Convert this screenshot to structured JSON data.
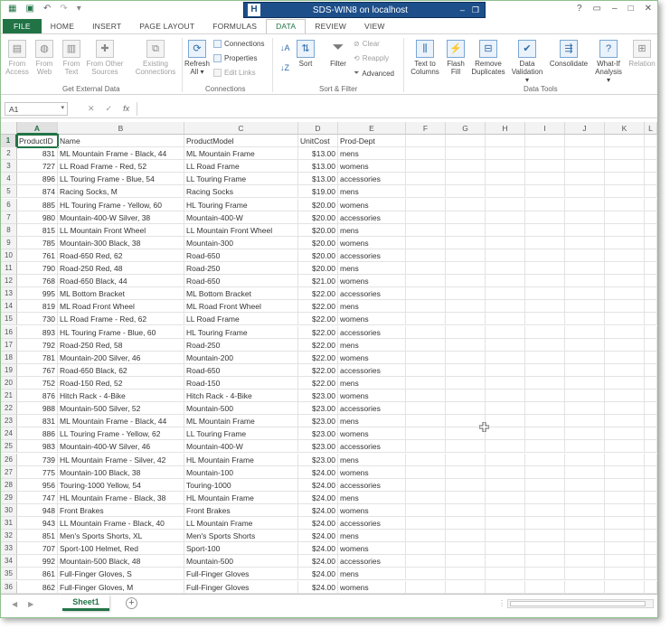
{
  "window": {
    "remote_title": "SDS-WIN8 on localhost",
    "remote_icon": "H"
  },
  "ribbon_tabs": [
    "FILE",
    "HOME",
    "INSERT",
    "PAGE LAYOUT",
    "FORMULAS",
    "DATA",
    "REVIEW",
    "VIEW"
  ],
  "ribbon": {
    "get_external": {
      "label": "Get External Data",
      "from_access": [
        "From",
        "Access"
      ],
      "from_web": [
        "From",
        "Web"
      ],
      "from_text": [
        "From",
        "Text"
      ],
      "from_other": [
        "From Other",
        "Sources"
      ],
      "existing": [
        "Existing",
        "Connections"
      ]
    },
    "connections": {
      "label": "Connections",
      "refresh": [
        "Refresh",
        "All"
      ],
      "connections": "Connections",
      "properties": "Properties",
      "edit_links": "Edit Links"
    },
    "sort_filter": {
      "label": "Sort & Filter",
      "sort": "Sort",
      "filter": "Filter",
      "clear": "Clear",
      "reapply": "Reapply",
      "advanced": "Advanced"
    },
    "data_tools": {
      "label": "Data Tools",
      "text_to_columns": [
        "Text to",
        "Columns"
      ],
      "flash_fill": [
        "Flash",
        "Fill"
      ],
      "remove_dup": [
        "Remove",
        "Duplicates"
      ],
      "data_validation": [
        "Data",
        "Validation"
      ],
      "consolidate": "Consolidate",
      "what_if": [
        "What-If",
        "Analysis"
      ],
      "relationships": "Relation"
    }
  },
  "formula_bar": {
    "name_box": "A1",
    "fx": "fx",
    "value": ""
  },
  "columns": [
    "A",
    "B",
    "C",
    "D",
    "E",
    "F",
    "G",
    "H",
    "I",
    "J",
    "K",
    "L"
  ],
  "headers": [
    "ProductID",
    "Name",
    "ProductModel",
    "UnitCost",
    "Prod-Dept"
  ],
  "rows": [
    [
      "831",
      "ML Mountain Frame - Black, 44",
      "ML Mountain Frame",
      "$13.00",
      "mens"
    ],
    [
      "727",
      "LL Road Frame - Red, 52",
      "LL Road Frame",
      "$13.00",
      "womens"
    ],
    [
      "896",
      "LL Touring Frame - Blue, 54",
      "LL Touring Frame",
      "$13.00",
      "accessories"
    ],
    [
      "874",
      "Racing Socks, M",
      "Racing Socks",
      "$19.00",
      "mens"
    ],
    [
      "885",
      "HL Touring Frame - Yellow, 60",
      "HL Touring Frame",
      "$20.00",
      "womens"
    ],
    [
      "980",
      "Mountain-400-W Silver, 38",
      "Mountain-400-W",
      "$20.00",
      "accessories"
    ],
    [
      "815",
      "LL Mountain Front Wheel",
      "LL Mountain Front Wheel",
      "$20.00",
      "mens"
    ],
    [
      "785",
      "Mountain-300 Black, 38",
      "Mountain-300",
      "$20.00",
      "womens"
    ],
    [
      "761",
      "Road-650 Red, 62",
      "Road-650",
      "$20.00",
      "accessories"
    ],
    [
      "790",
      "Road-250 Red, 48",
      "Road-250",
      "$20.00",
      "mens"
    ],
    [
      "768",
      "Road-650 Black, 44",
      "Road-650",
      "$21.00",
      "womens"
    ],
    [
      "995",
      "ML Bottom Bracket",
      "ML Bottom Bracket",
      "$22.00",
      "accessories"
    ],
    [
      "819",
      "ML Road Front Wheel",
      "ML Road Front Wheel",
      "$22.00",
      "mens"
    ],
    [
      "730",
      "LL Road Frame - Red, 62",
      "LL Road Frame",
      "$22.00",
      "womens"
    ],
    [
      "893",
      "HL Touring Frame - Blue, 60",
      "HL Touring Frame",
      "$22.00",
      "accessories"
    ],
    [
      "792",
      "Road-250 Red, 58",
      "Road-250",
      "$22.00",
      "mens"
    ],
    [
      "781",
      "Mountain-200 Silver, 46",
      "Mountain-200",
      "$22.00",
      "womens"
    ],
    [
      "767",
      "Road-650 Black, 62",
      "Road-650",
      "$22.00",
      "accessories"
    ],
    [
      "752",
      "Road-150 Red, 52",
      "Road-150",
      "$22.00",
      "mens"
    ],
    [
      "876",
      "Hitch Rack - 4-Bike",
      "Hitch Rack - 4-Bike",
      "$23.00",
      "womens"
    ],
    [
      "988",
      "Mountain-500 Silver, 52",
      "Mountain-500",
      "$23.00",
      "accessories"
    ],
    [
      "831",
      "ML Mountain Frame - Black, 44",
      "ML Mountain Frame",
      "$23.00",
      "mens"
    ],
    [
      "886",
      "LL Touring Frame - Yellow, 62",
      "LL Touring Frame",
      "$23.00",
      "womens"
    ],
    [
      "983",
      "Mountain-400-W Silver, 46",
      "Mountain-400-W",
      "$23.00",
      "accessories"
    ],
    [
      "739",
      "HL Mountain Frame - Silver, 42",
      "HL Mountain Frame",
      "$23.00",
      "mens"
    ],
    [
      "775",
      "Mountain-100 Black, 38",
      "Mountain-100",
      "$24.00",
      "womens"
    ],
    [
      "956",
      "Touring-1000 Yellow, 54",
      "Touring-1000",
      "$24.00",
      "accessories"
    ],
    [
      "747",
      "HL Mountain Frame - Black, 38",
      "HL Mountain Frame",
      "$24.00",
      "mens"
    ],
    [
      "948",
      "Front Brakes",
      "Front Brakes",
      "$24.00",
      "womens"
    ],
    [
      "943",
      "LL Mountain Frame - Black, 40",
      "LL Mountain Frame",
      "$24.00",
      "accessories"
    ],
    [
      "851",
      "Men's Sports Shorts, XL",
      "Men's Sports Shorts",
      "$24.00",
      "mens"
    ],
    [
      "707",
      "Sport-100 Helmet, Red",
      "Sport-100",
      "$24.00",
      "womens"
    ],
    [
      "992",
      "Mountain-500 Black, 48",
      "Mountain-500",
      "$24.00",
      "accessories"
    ],
    [
      "861",
      "Full-Finger Gloves, S",
      "Full-Finger Gloves",
      "$24.00",
      "mens"
    ],
    [
      "862",
      "Full-Finger Gloves, M",
      "Full-Finger Gloves",
      "$24.00",
      "womens"
    ]
  ],
  "sheet": {
    "tab_name": "Sheet1",
    "add_label": "+"
  },
  "colors": {
    "accent": "#217346",
    "remote_bar": "#1d4f8a"
  }
}
